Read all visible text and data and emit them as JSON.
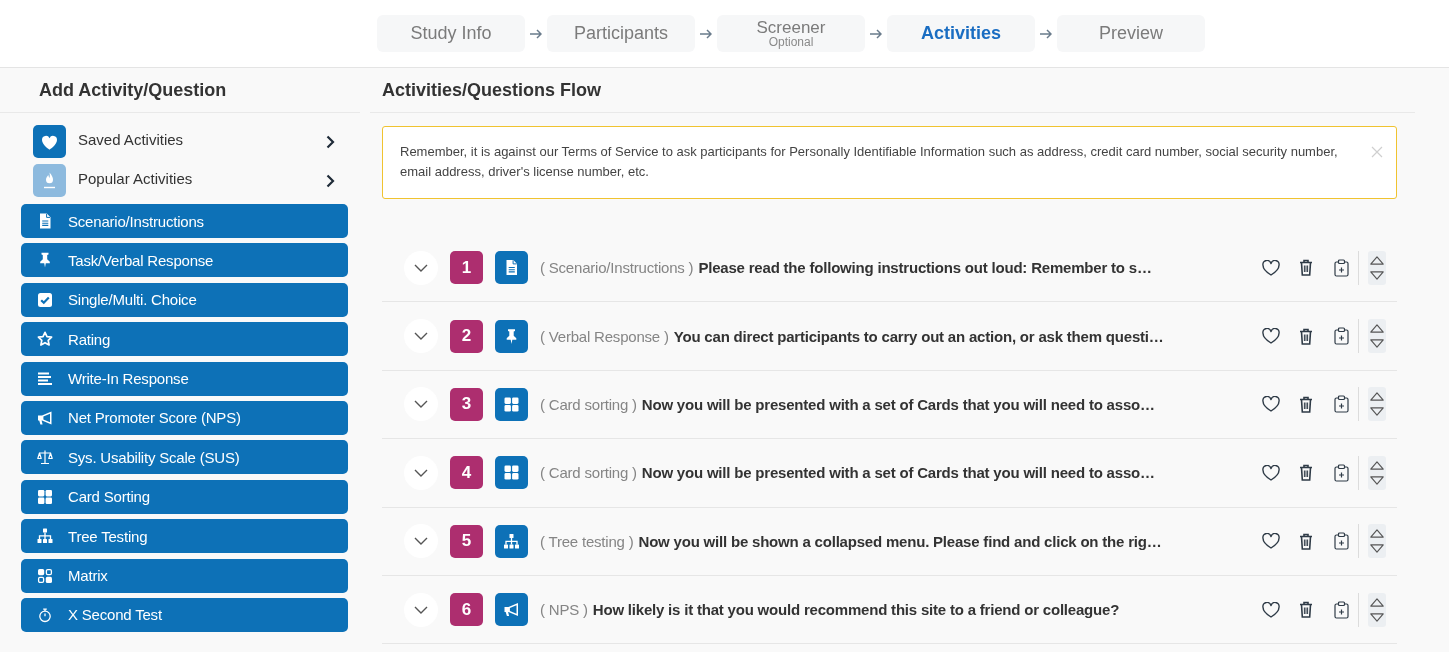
{
  "steps": [
    {
      "label": "Study Info",
      "selected": false
    },
    {
      "label": "Participants",
      "selected": false
    },
    {
      "label": "Screener",
      "note": "Optional",
      "selected": false
    },
    {
      "label": "Activities",
      "selected": true
    },
    {
      "label": "Preview",
      "selected": false
    }
  ],
  "sidebar": {
    "title": "Add Activity/Question",
    "collections": [
      {
        "kind": "saved",
        "label": "Saved Activities"
      },
      {
        "kind": "popular",
        "label": "Popular Activities"
      }
    ],
    "activity_types": [
      {
        "kind": "scenario",
        "label": "Scenario/Instructions"
      },
      {
        "kind": "task",
        "label": "Task/Verbal Response"
      },
      {
        "kind": "choice",
        "label": "Single/Multi. Choice"
      },
      {
        "kind": "rating",
        "label": "Rating"
      },
      {
        "kind": "write_in",
        "label": "Write-In Response"
      },
      {
        "kind": "nps",
        "label": "Net Promoter Score (NPS)"
      },
      {
        "kind": "sus",
        "label": "Sys. Usability Scale (SUS)"
      },
      {
        "kind": "card_sorting",
        "label": "Card Sorting"
      },
      {
        "kind": "tree_testing",
        "label": "Tree Testing"
      },
      {
        "kind": "matrix",
        "label": "Matrix"
      },
      {
        "kind": "x_second",
        "label": "X Second Test"
      }
    ]
  },
  "flow": {
    "title": "Activities/Questions Flow",
    "notice": "Remember, it is against our Terms of Service to ask participants for Personally Identifiable Information such as address, credit card number, social security number, email address, driver's license number, etc.",
    "activities": [
      {
        "number": "1",
        "kind": "scenario",
        "type_label": "( Scenario/Instructions )",
        "text": "Please read the following instructions out loud: Remember to s…"
      },
      {
        "number": "2",
        "kind": "task",
        "type_label": "( Verbal Response )",
        "text": "You can direct participants to carry out an action, or ask them questi…"
      },
      {
        "number": "3",
        "kind": "card_sorting",
        "type_label": "( Card sorting )",
        "text": "Now you will be presented with a set of Cards that you will need to asso…"
      },
      {
        "number": "4",
        "kind": "card_sorting",
        "type_label": "( Card sorting )",
        "text": "Now you will be presented with a set of Cards that you will need to asso…"
      },
      {
        "number": "5",
        "kind": "tree_testing",
        "type_label": "( Tree testing )",
        "text": "Now you will be shown a collapsed menu. Please find and click on the rig…"
      },
      {
        "number": "6",
        "kind": "nps",
        "type_label": "( NPS )",
        "text": "How likely is it that you would recommend this site to a friend or colleague?"
      }
    ]
  }
}
